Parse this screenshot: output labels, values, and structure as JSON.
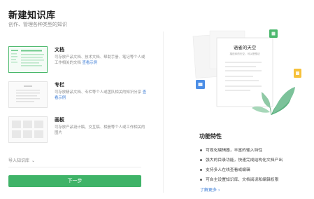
{
  "header": {
    "title": "新建知识库",
    "subtitle": "创作、管理各种类型的知识"
  },
  "options": [
    {
      "title": "文档",
      "desc": "可存放产品文档、技术文档、帮助手册、笔记等个人或工作相关的文档",
      "link": "查看示例",
      "selected": true
    },
    {
      "title": "专栏",
      "desc": "可存放精品文档、专栏等个人或团队相关的知识分享",
      "link": "查看示例",
      "selected": false
    },
    {
      "title": "画板",
      "desc": "可存放产品设计稿、交互稿、相册等个人或工作相关的图片",
      "link": "",
      "selected": false
    }
  ],
  "import_label": "导入知识库",
  "next_button": "下一步",
  "illustration": {
    "card_title": "语雀的天空",
    "card_subtitle": "描述你的天空，可以是想法"
  },
  "features": {
    "title": "功能特性",
    "items": [
      "可视化编辑器，丰富的输入特性",
      "强大的目录功能，快速完成结构化文档产出",
      "支持多人在线查看或编辑",
      "可自主设置知识库、文档阅读和编辑权限"
    ],
    "more_link": "了解更多"
  },
  "colors": {
    "accent": "#3fb368",
    "link": "#3a7bd5"
  }
}
